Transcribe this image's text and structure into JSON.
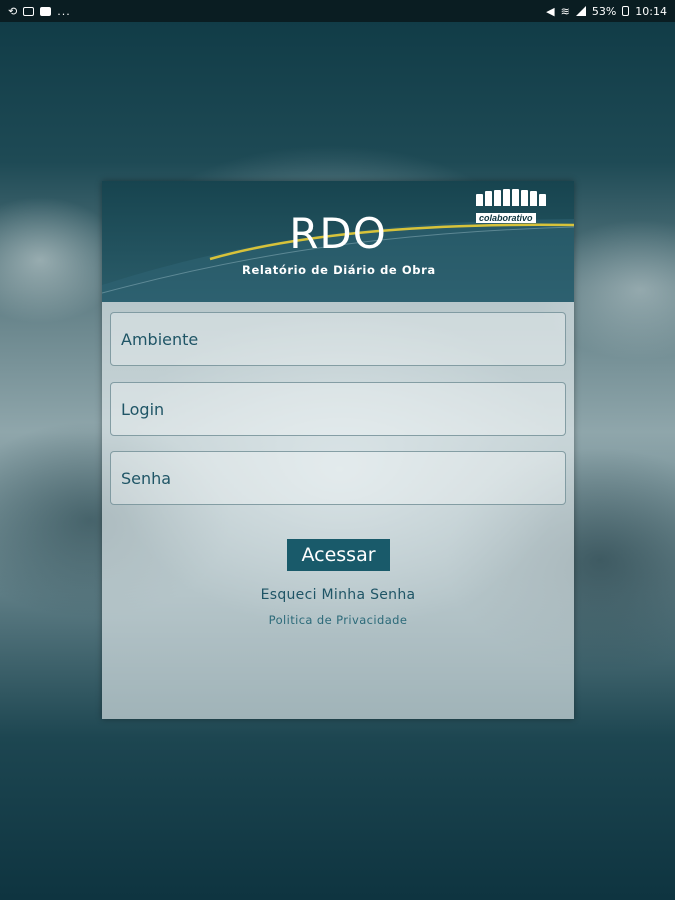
{
  "status_bar": {
    "left_icons": [
      "sync-icon",
      "chat-icon",
      "flipboard-icon"
    ],
    "overflow": "...",
    "battery": "53%",
    "time": "10:14"
  },
  "header": {
    "title": "RDO",
    "subtitle": "Relatório de Diário de Obra",
    "logo_text": "colaborativo"
  },
  "form": {
    "environment_placeholder": "Ambiente",
    "login_placeholder": "Login",
    "password_placeholder": "Senha",
    "submit_label": "Acessar",
    "forgot_label": "Esqueci Minha Senha",
    "privacy_label": "Politica de Privacidade"
  },
  "colors": {
    "header_bg": "#17444f",
    "accent_line": "#d7c23a",
    "button_bg": "#195a6a",
    "text": "#1f5566"
  }
}
